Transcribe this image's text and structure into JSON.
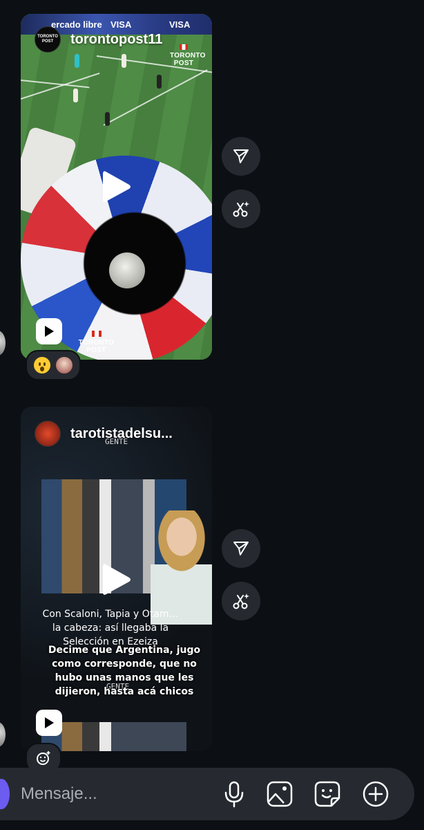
{
  "messages": [
    {
      "author": "torontopost11",
      "avatar_text": "TORONTO POST",
      "banner_ads": [
        "ercado libre",
        "VISA",
        "VISA"
      ],
      "watermark_top": "TORONTO POST",
      "watermark_bottom": "TORONTO POST",
      "reactions_icon": "astonished-face-emoji"
    },
    {
      "author": "tarotistadelsu...",
      "gente_label": "GENTE",
      "caption_top": "Con Scaloni, Tapia y Otam… la cabeza: así llegaba la Selección en Ezeiza",
      "caption_overlay": "Decime que Argentina, jugo como corresponde, que no hubo unas manos que les dijieron, hasta acá chicos",
      "gente_label_2": "GENTE"
    }
  ],
  "actions": {
    "share_icon": "send-icon",
    "remix_icon": "scissors-sparkle-icon"
  },
  "composer": {
    "placeholder": "Mensaje...",
    "icons": [
      "microphone-icon",
      "image-icon",
      "sticker-icon",
      "plus-circle-icon"
    ]
  },
  "colors": {
    "background": "#0c1014",
    "surface": "#262a30",
    "accent": "#6d5cf0"
  }
}
